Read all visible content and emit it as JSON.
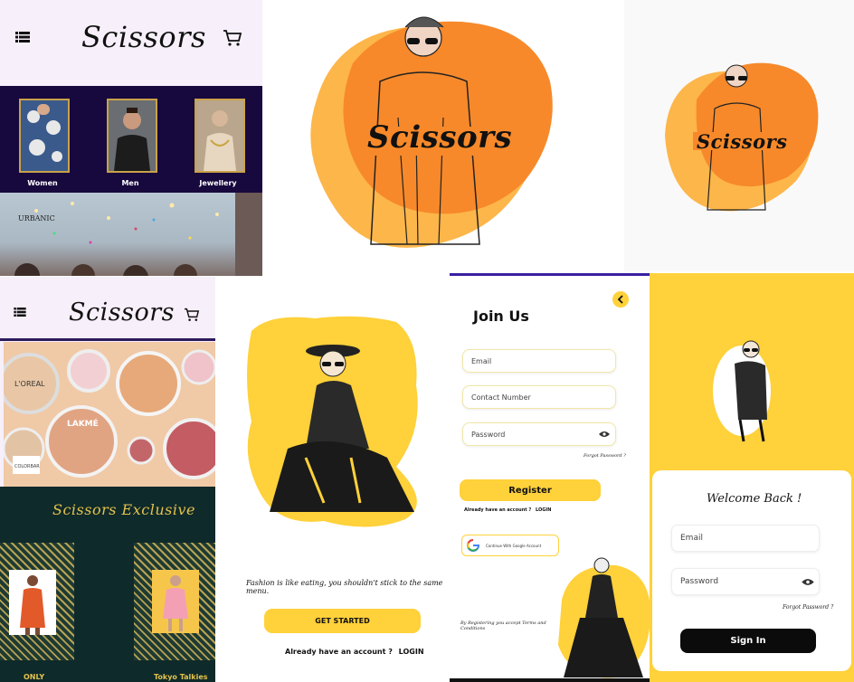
{
  "colors": {
    "accent_yellow": "#ffd13a",
    "orange": "#f7892a",
    "navy": "#17083d",
    "dark_green": "#0f2a2a",
    "gold": "#e4c24d",
    "pink_bg": "#f7eff9"
  },
  "panel1": {
    "logo": "Scissors",
    "icons": {
      "menu": "list-icon",
      "cart": "cart-icon"
    },
    "categories": [
      {
        "label": "Women"
      },
      {
        "label": "Men"
      },
      {
        "label": "Jewellery"
      }
    ],
    "banner_text": "URBANIC"
  },
  "splash": {
    "logo": "Scissors"
  },
  "panel4": {
    "logo": "Scissors",
    "cosmetics_labels": {
      "brand1": "L'OREAL",
      "brand2": "LAKMÉ",
      "brand3": "COLORBAR"
    },
    "exclusive_title": "Scissors Exclusive",
    "brands": [
      {
        "label": "ONLY"
      },
      {
        "label": "Tokyo Talkies"
      }
    ]
  },
  "intro": {
    "tagline": "Fashion is like eating, you shouldn't stick to the same menu.",
    "cta": "GET STARTED",
    "login_prompt": "Already have an account ?",
    "login_link": "LOGIN"
  },
  "join": {
    "title": "Join Us",
    "email_placeholder": "Email",
    "contact_placeholder": "Contact Number",
    "password_placeholder": "Password",
    "forgot": "Forgot Password ?",
    "register": "Register",
    "login_prompt": "Already have an account ?",
    "login_link": "LOGIN",
    "google": "Continue With Google Account",
    "terms": "By Registering you accept Terms and Conditions"
  },
  "welcome": {
    "title": "Welcome Back !",
    "email_placeholder": "Email",
    "password_placeholder": "Password",
    "forgot": "Forgot Password ?",
    "sign_in": "Sign In"
  }
}
